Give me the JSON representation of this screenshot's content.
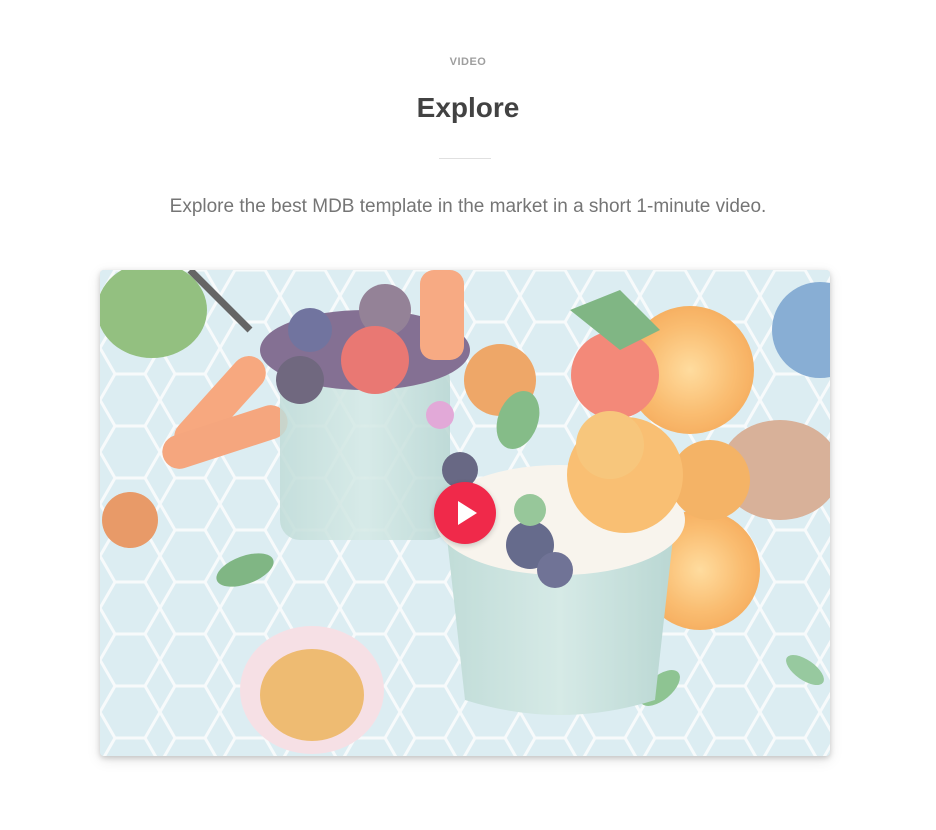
{
  "section": {
    "eyebrow": "VIDEO",
    "title": "Explore",
    "lead": "Explore the best MDB template in the market in a short 1-minute video."
  },
  "video": {
    "play_icon": "play-icon",
    "accent_color": "#f0294a"
  }
}
